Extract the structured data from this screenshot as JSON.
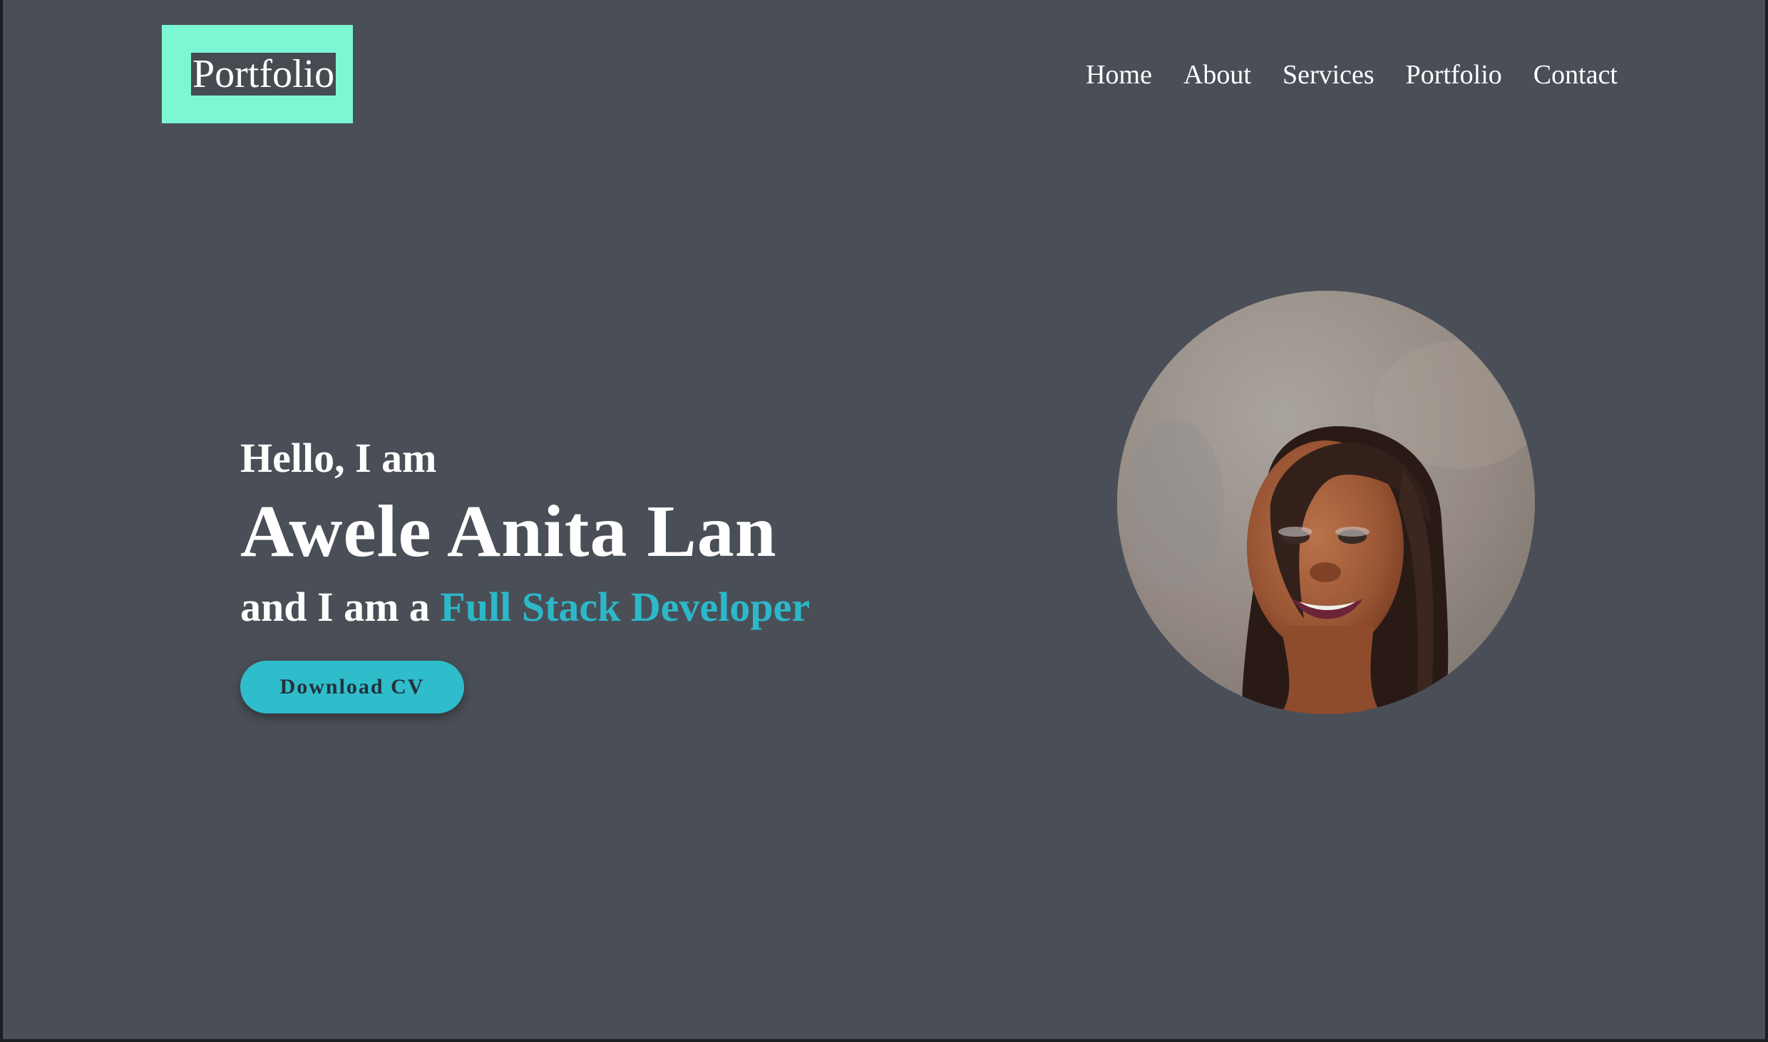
{
  "header": {
    "logo_text": "Portfolio",
    "nav": [
      "Home",
      "About",
      "Services",
      "Portfolio",
      "Contact"
    ]
  },
  "hero": {
    "greeting": "Hello, I am",
    "name": "Awele Anita Lan",
    "role_prefix": "and I am a ",
    "role": "Full Stack Developer",
    "cv_button": "Download CV"
  },
  "colors": {
    "background": "#4a4f57",
    "logo_accent": "#7cf7d4",
    "accent": "#2cb8c8",
    "text": "#ffffff"
  }
}
